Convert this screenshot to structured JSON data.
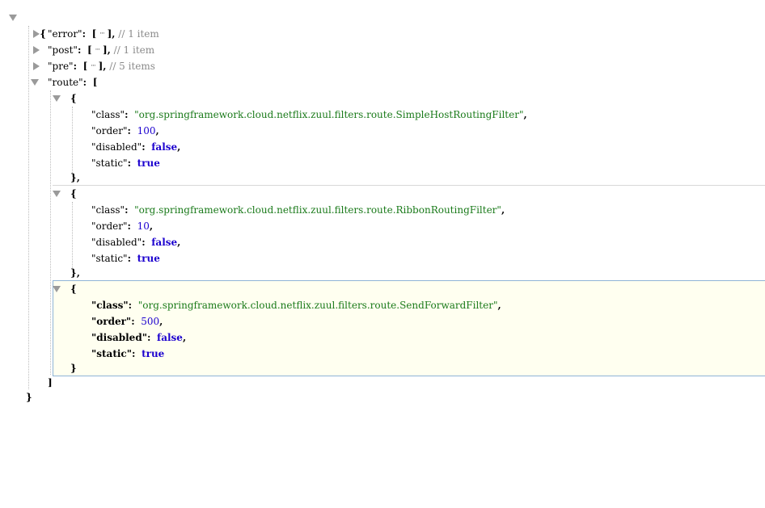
{
  "tokens": {
    "open_brace": "{",
    "close_brace": "}",
    "open_bracket": "[",
    "close_bracket": "]",
    "collapsed_marker": "···",
    "colon": ":",
    "comma": ","
  },
  "root": {
    "collapsed_sections": [
      {
        "key": "\"error\"",
        "comment": "// 1 item"
      },
      {
        "key": "\"post\"",
        "comment": "// 1 item"
      },
      {
        "key": "\"pre\"",
        "comment": "// 5 items"
      }
    ],
    "route": {
      "key": "\"route\"",
      "items": [
        {
          "class_key": "\"class\"",
          "class_value": "\"org.springframework.cloud.netflix.zuul.filters.route.SimpleHostRoutingFilter\"",
          "order_key": "\"order\"",
          "order_value": "100",
          "disabled_key": "\"disabled\"",
          "disabled_value": "false",
          "static_key": "\"static\"",
          "static_value": "true"
        },
        {
          "class_key": "\"class\"",
          "class_value": "\"org.springframework.cloud.netflix.zuul.filters.route.RibbonRoutingFilter\"",
          "order_key": "\"order\"",
          "order_value": "10",
          "disabled_key": "\"disabled\"",
          "disabled_value": "false",
          "static_key": "\"static\"",
          "static_value": "true"
        },
        {
          "class_key": "\"class\"",
          "class_value": "\"org.springframework.cloud.netflix.zuul.filters.route.SendForwardFilter\"",
          "order_key": "\"order\"",
          "order_value": "500",
          "disabled_key": "\"disabled\"",
          "disabled_value": "false",
          "static_key": "\"static\"",
          "static_value": "true"
        }
      ]
    }
  },
  "colors": {
    "string": "#1a7a1a",
    "number": "#1c00cf",
    "boolean": "#1c00cf",
    "comment": "#8a8a8a",
    "hover_background": "#fffff0",
    "hover_border": "#8fb4d6"
  },
  "icons": {
    "expanded": "triangle-down-icon",
    "collapsed": "triangle-right-icon"
  }
}
